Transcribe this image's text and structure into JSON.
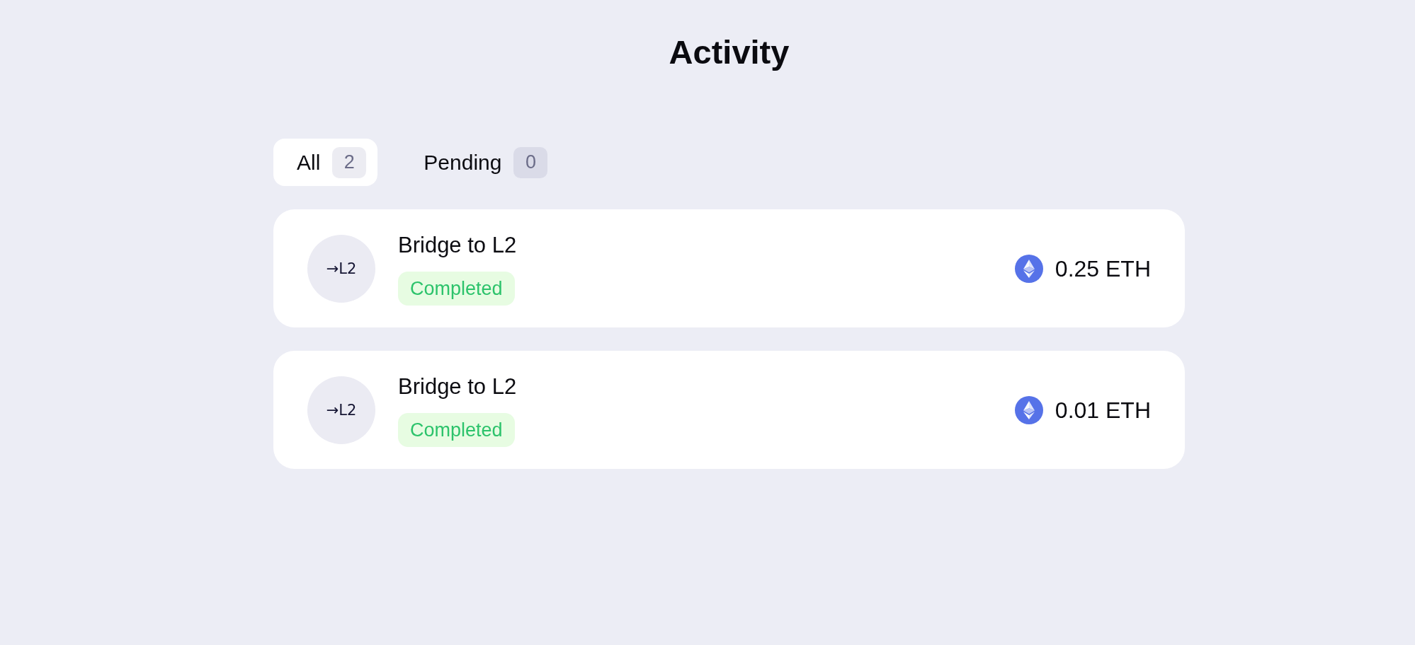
{
  "page": {
    "title": "Activity"
  },
  "tabs": [
    {
      "label": "All",
      "count": "2",
      "selected": true
    },
    {
      "label": "Pending",
      "count": "0",
      "selected": false
    }
  ],
  "transactions": [
    {
      "icon_label": "→L2",
      "title": "Bridge to L2",
      "status": {
        "kind": "completed",
        "label": "Completed"
      },
      "amount": "0.25 ETH"
    },
    {
      "icon_label": "→L2",
      "title": "Bridge to L2",
      "status": {
        "kind": "completed",
        "label": "Completed"
      },
      "amount": "0.01 ETH"
    }
  ]
}
